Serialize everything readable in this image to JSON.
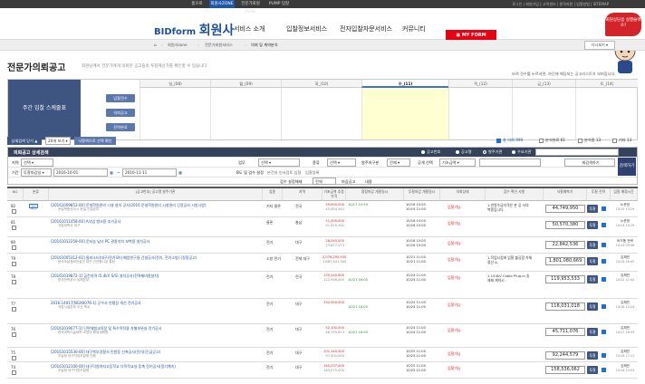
{
  "topbar": {
    "tabs": [
      "홈으로",
      "회원사ZONE",
      "전문가회원ZONE",
      "PUMP 입찰"
    ],
    "active": 1,
    "links": "로그인 | 회원가입 | 고객센터 | 원격지원 | 입찰방법 | SITEMAP"
  },
  "header": {
    "logo_prefix": "BIDform",
    "logo_main": "회원사",
    "nav": [
      "서비스 소개",
      "입찰정보서비스",
      "전자입찰자문서비스",
      "커뮤니티"
    ],
    "myform": "MY FORM",
    "help_badge": "회원상담용 실행슬랙쓰?"
  },
  "crumbs": [
    "회원사zone",
    "전문가회원서비스",
    "의뢰 및 계약분석"
  ],
  "dropdown": "다시보기",
  "page": {
    "title": "전문가의뢰공고",
    "desc": "회원님께서 전문가에게 의뢰된 공고들의 투찰계산가를 확인할 수 있습니다.",
    "note": "보려 견수를 누르셔면, 하단에 해당되는 공고리스트가 보여집니다."
  },
  "calendar": {
    "left_label": "주간 입찰 스케줄표",
    "buttons": [
      "입찰견수",
      "의뢰공고",
      "전략완료"
    ],
    "days": [
      "일_(08)",
      "월_(09)",
      "화_(10)",
      "수_(11)",
      "목_(12)",
      "금_(13)",
      "토_(14)"
    ],
    "highlight": 3
  },
  "filters": {
    "collapse": "상세검색 닫기 ▲",
    "perpage": "20개 보기",
    "export": "낙찰액으로 선택 확인",
    "checks": [
      {
        "label": "총 의뢰 999",
        "on": true
      },
      {
        "label": "분석완료 61",
        "on": false
      },
      {
        "label": "분석중 13",
        "on": false
      },
      {
        "label": "기타 13",
        "on": false
      }
    ]
  },
  "search": {
    "title": "의뢰공고 상세검색",
    "radios": [
      "공고번호",
      "공고명",
      "발주기관",
      "수요기관"
    ],
    "radio_active": 2,
    "row1": {
      "region_lbl": "지역",
      "region": "선택",
      "biz_lbl": "업무",
      "biz": "선택",
      "type_lbl": "종류",
      "type": "선택",
      "method_lbl": "발주처구분",
      "method": "전체",
      "sort_lbl": "공개 선택",
      "sort": "기초금액"
    },
    "row2": {
      "period_lbl": "기간",
      "period_type": "투찰마감일",
      "from": "2016-10-01",
      "to": "2016-11-11",
      "opt_lbl": "B도 및 검수 설정",
      "opt1": "본건자 인서검토 입찰",
      "opt2": "입찰등록"
    },
    "row3": {
      "lbl": "검수 설정해제",
      "val": "전체",
      "chk1": "마감공고",
      "chk2": "내용"
    },
    "go": "검색하기",
    "reset": "재검색하기"
  },
  "grid": {
    "headers": [
      "NO",
      "분류",
      "[공고번호] 공고명\n발주기관",
      "업종",
      "지역",
      "기초금액\n추정가격",
      "협정마감\n개찰일시",
      "투찰마감\n개찰일시",
      "의뢰상태",
      "검수 확인 사항",
      "낙찰예측가",
      "투찰\n전략",
      "입찰\n예정시간"
    ],
    "rows": [
      {
        "no": "82",
        "tag": "전자 공고",
        "title": "[20161009853-00] 운설학원관리 시설 설치 공사(2016 운설학원관리 시설관리 긴장공사 시방시방)",
        "org": "운설학원관리시 운설 건설본부",
        "biz": "기타 물론",
        "area": "전국",
        "price1": "59,000,000",
        "price2": "45,454,545",
        "date1": "10/17 10:59",
        "date2": "",
        "date3": "10/18 15:00",
        "date4": "10/19 11:00",
        "status": "입찰가능",
        "note": "1.만원수급자격은 본 공 사의 복종입니다.",
        "pred": "44,749,950",
        "time1": "노준영",
        "time2": "10/15 13:29"
      },
      {
        "no": "81",
        "tag": "",
        "title": "[20161011458-00] A사업 뱅크용 추가공사",
        "org": "국립대학교 대구",
        "biz": "물론",
        "area": "충남",
        "price1": "51,000,000",
        "price2": "51,615,182",
        "date1": "",
        "date2": "",
        "date3": "10/18 15:00",
        "date4": "10/18 15:00",
        "status": "입찰가능",
        "note": "",
        "pred": "50,570,380",
        "time1": "노준영",
        "time2": "10/14 10:29"
      },
      {
        "no": "80",
        "tag": "",
        "title": "[20161012259-00] 운터농 남녀 PC 관중석치 보벽용 설치공사",
        "org": "",
        "biz": "전기",
        "area": "대구",
        "price1": "26,045,000",
        "price2": "23,677,273",
        "date1": "",
        "date2": "",
        "date3": "10/18 15:00",
        "date4": "10/18 15:00",
        "status": "입찰가능",
        "note": "",
        "pred": "22,842,536",
        "time1": "비드폼 전략",
        "time2": "10/14 09:46"
      },
      {
        "no": "79",
        "tag": "",
        "title": "[20161005312-02] 울비소터(대구)전기모터 폐업한구용 건설공사(전기, 전기소방) (정정공고)",
        "org": "한국조달청비전설관 대구 건전용시공 통한",
        "biz": "소방 전기",
        "area": "전체 대구",
        "price1": "2,076,295,930",
        "price2": "1,887,541,300",
        "date1": "",
        "date2": "",
        "date3": "10/21 11:00",
        "date4": "10/21 11:00",
        "status": "입찰가능",
        "note": "1.작업시점에 입찰 불공함 자체 정산 A.",
        "pred": "1,801,080,669",
        "time1": "김채민",
        "time2": "10/14 16:45"
      },
      {
        "no": "78",
        "tag": "",
        "title": "[20161019872-1] 금전지역 (5.4kV S/S) 설치공사(전력제비용설치)",
        "org": "한국전력공사 남해본부",
        "biz": "전기",
        "area": "전국",
        "price1": "135,240,600",
        "price2": "122,946,000",
        "date1": "",
        "date2": "10/21 16:00",
        "date3": "10/24 11:00",
        "date4": "10/24 11:00",
        "status": "입찰가능",
        "note": "1.154kV Cable Plug-in 송 체재 계약시.",
        "pred": "119,953,533",
        "time1": "김채민",
        "time2": "10/15 11:43"
      },
      {
        "no": "77",
        "tag": "",
        "title": "2016-14917[NGX0076-1] 군수사 연평장 개선 전기공사",
        "org": "국방시설본부 우산 학교",
        "biz": "전기",
        "area": "대구",
        "price1": "134,900,000",
        "price2": "",
        "date1": "",
        "date2": "10/21 16:00",
        "date3": "10/24 11:00",
        "date4": "10/24 11:00",
        "status": "입찰가능",
        "note": "",
        "pred": "118,031,018",
        "time1": "김채민",
        "time2": "10/18 15:24"
      },
      {
        "no": "76",
        "tag": "",
        "title": "[20161019077-1] 단면체험교육장 및 특수목적용 차별보완실 전기공사",
        "org": "한국과학기술대학 소방대 행정계획원",
        "biz": "전기",
        "area": "대구",
        "price1": "52,100,000",
        "price2": "46,755,813",
        "date1": "",
        "date2": "10/21 16:00",
        "date3": "10/24 11:00",
        "date4": "10/24 11:00",
        "status": "입찰가능",
        "note": "",
        "pred": "45,711,076",
        "time1": "김채민",
        "time2": "10/17 16:43"
      },
      {
        "no": "75",
        "tag": "",
        "title": "[20161015530-00] 대구북부경찰서 민원동 신축공사(전기)(긴급공고)",
        "org": "조달청 대구지방조달청 민원",
        "biz": "전기",
        "area": "대구",
        "price1": "101,140,000",
        "price2": "97,400,000",
        "date1": "",
        "date2": "",
        "date3": "10/25 11:00",
        "date4": "10/25 11:00",
        "status": "입찰가능",
        "note": "",
        "pred": "92,244,579",
        "time1": "김채민",
        "time2": "10/18 17:11"
      },
      {
        "no": "74",
        "tag": "",
        "title": "[20161012100-00] 대구덕원여자고등학교 다목적교실 증축 전기공사(알기계속)",
        "org": "조달청 대구지방조달청",
        "biz": "전기",
        "area": "대구",
        "price1": "165,037,000",
        "price2": "163,575,000",
        "date1": "",
        "date2": "",
        "date3": "10/25 11:00",
        "date4": "10/25 11:00",
        "status": "입찰가능",
        "note": "",
        "pred": "158,536,062",
        "time1": "김채민",
        "time2": "10/18 15:53"
      }
    ],
    "bid_btn": "투찰"
  },
  "colors": {
    "navy": "#3e5582",
    "accent_red": "#e60012",
    "highlight": "#ffffd2"
  }
}
